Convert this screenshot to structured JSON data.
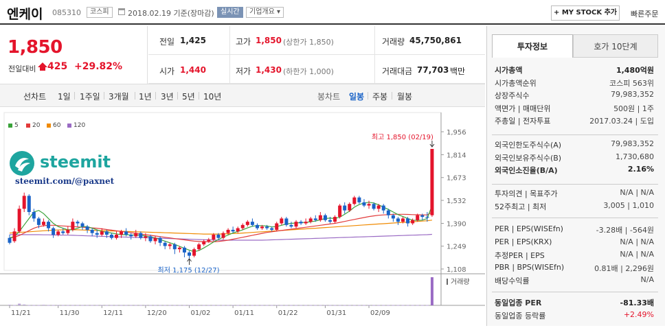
{
  "header": {
    "name": "엔케이",
    "code": "085310",
    "market": "코스피",
    "date": "2018.02.19 기준(장마감)",
    "realtime": "실시간",
    "corp_info": "기업개요 ▾",
    "my_stock": "+ MY STOCK 추가",
    "quick_order": "빠른주문"
  },
  "price": {
    "current": "1,850",
    "diff_label": "전일대비",
    "diff": "425",
    "rate": "+29.82%"
  },
  "summary": {
    "prev_label": "전일",
    "prev": "1,425",
    "high_label": "고가",
    "high": "1,850",
    "high_sub": "(상한가 1,850)",
    "volume_label": "거래량",
    "volume": "45,750,861",
    "open_label": "시가",
    "open": "1,440",
    "low_label": "저가",
    "low": "1,430",
    "low_sub": "(하한가 1,000)",
    "amount_label": "거래대금",
    "amount": "77,703",
    "amount_unit": "백만"
  },
  "tabs": {
    "line": "선차트",
    "d1": "1일",
    "w1": "1주일",
    "m3": "3개월",
    "y1": "1년",
    "y3": "3년",
    "y5": "5년",
    "y10": "10년",
    "candle": "봉차트",
    "daily": "일봉",
    "weekly": "주봉",
    "monthly": "월봉"
  },
  "right": {
    "tab_info": "투자정보",
    "tab_quote": "호가 10단계",
    "rows1": [
      {
        "l": "시가총액",
        "r": "1,480억원",
        "bold": true
      },
      {
        "l": "시가총액순위",
        "r": "코스피 563위"
      },
      {
        "l": "상장주식수",
        "r": "79,983,352"
      },
      {
        "l": "액면가 | 매매단위",
        "r": "500원 | 1주"
      },
      {
        "l": "주총일 | 전자투표",
        "r": "2017.03.24 | 도입"
      }
    ],
    "rows2": [
      {
        "l": "외국인한도주식수(A)",
        "r": "79,983,352"
      },
      {
        "l": "외국인보유주식수(B)",
        "r": "1,730,680"
      },
      {
        "l": "외국인소진율(B/A)",
        "r": "2.16%",
        "bold": true
      }
    ],
    "rows3": [
      {
        "l": "투자의견 | 목표주가",
        "r": "N/A | N/A"
      },
      {
        "l": "52주최고 | 최저",
        "r": "3,005 | 1,010"
      }
    ],
    "rows4": [
      {
        "l": "PER | EPS(WISEfn)",
        "r": "-3.28배 | -564원"
      },
      {
        "l": "PER | EPS(KRX)",
        "r": "N/A | N/A"
      },
      {
        "l": "추정PER | EPS",
        "r": "N/A | N/A"
      },
      {
        "l": "PBR | BPS(WISEfn)",
        "r": "0.81배 | 2,296원"
      },
      {
        "l": "배당수익률",
        "r": "N/A"
      }
    ],
    "rows5": [
      {
        "l": "동일업종 PER",
        "r": "-81.33배",
        "bold": true
      },
      {
        "l": "동일업종 등락률",
        "r": "+2.49%",
        "red": true
      }
    ]
  },
  "watermark": {
    "brand": "steemit",
    "url": "steemit.com/@paxnet"
  },
  "colors": {
    "up": "#e4142b",
    "down": "#1a63c7",
    "ma5": "#3aa23a",
    "ma20": "#e23a3a",
    "ma60": "#f08a00",
    "ma120": "#9a6bc4",
    "steemit": "#1ea59f"
  },
  "chart_data": {
    "type": "candlestick",
    "legend": [
      "5",
      "20",
      "60",
      "120"
    ],
    "y_ticks": [
      "1,956",
      "1,814",
      "1,673",
      "1,532",
      "1,390",
      "1,249",
      "1,108"
    ],
    "ylim": [
      1108,
      1956
    ],
    "x_ticks": [
      "11/21",
      "11/30",
      "12/11",
      "12/20",
      "01/02",
      "01/11",
      "01/22",
      "01/31",
      "02/09"
    ],
    "high_annotation": "최고 1,850 (02/19)",
    "low_annotation": "최저 1,175 (12/27)",
    "volume_label": "거래량",
    "candles": [
      [
        1300,
        1270,
        1320,
        1260
      ],
      [
        1280,
        1340,
        1360,
        1270
      ],
      [
        1340,
        1480,
        1500,
        1330
      ],
      [
        1480,
        1560,
        1580,
        1460
      ],
      [
        1560,
        1460,
        1570,
        1440
      ],
      [
        1460,
        1420,
        1480,
        1400
      ],
      [
        1420,
        1380,
        1430,
        1360
      ],
      [
        1380,
        1400,
        1420,
        1370
      ],
      [
        1400,
        1360,
        1410,
        1340
      ],
      [
        1360,
        1320,
        1370,
        1300
      ],
      [
        1320,
        1340,
        1350,
        1310
      ],
      [
        1340,
        1330,
        1360,
        1320
      ],
      [
        1330,
        1350,
        1370,
        1320
      ],
      [
        1350,
        1400,
        1420,
        1340
      ],
      [
        1400,
        1390,
        1410,
        1370
      ],
      [
        1390,
        1370,
        1400,
        1350
      ],
      [
        1370,
        1350,
        1380,
        1330
      ],
      [
        1350,
        1330,
        1360,
        1310
      ],
      [
        1330,
        1320,
        1350,
        1300
      ],
      [
        1320,
        1340,
        1360,
        1310
      ],
      [
        1340,
        1320,
        1350,
        1300
      ],
      [
        1320,
        1300,
        1330,
        1290
      ],
      [
        1300,
        1320,
        1340,
        1290
      ],
      [
        1320,
        1340,
        1350,
        1300
      ],
      [
        1340,
        1320,
        1360,
        1310
      ],
      [
        1320,
        1310,
        1330,
        1290
      ],
      [
        1310,
        1330,
        1350,
        1300
      ],
      [
        1330,
        1300,
        1340,
        1290
      ],
      [
        1300,
        1310,
        1330,
        1280
      ],
      [
        1310,
        1280,
        1320,
        1270
      ],
      [
        1280,
        1300,
        1310,
        1260
      ],
      [
        1300,
        1270,
        1310,
        1250
      ],
      [
        1270,
        1250,
        1280,
        1230
      ],
      [
        1250,
        1260,
        1270,
        1230
      ],
      [
        1260,
        1230,
        1270,
        1200
      ],
      [
        1230,
        1240,
        1250,
        1210
      ],
      [
        1240,
        1210,
        1250,
        1180
      ],
      [
        1210,
        1190,
        1220,
        1175
      ],
      [
        1190,
        1230,
        1240,
        1180
      ],
      [
        1230,
        1260,
        1270,
        1220
      ],
      [
        1260,
        1280,
        1290,
        1250
      ],
      [
        1280,
        1290,
        1300,
        1270
      ],
      [
        1290,
        1320,
        1330,
        1280
      ],
      [
        1320,
        1300,
        1330,
        1290
      ],
      [
        1300,
        1330,
        1340,
        1290
      ],
      [
        1330,
        1350,
        1360,
        1320
      ],
      [
        1350,
        1340,
        1370,
        1330
      ],
      [
        1340,
        1360,
        1370,
        1330
      ],
      [
        1360,
        1380,
        1390,
        1350
      ],
      [
        1380,
        1400,
        1410,
        1370
      ],
      [
        1400,
        1380,
        1420,
        1370
      ],
      [
        1380,
        1360,
        1390,
        1350
      ],
      [
        1360,
        1370,
        1380,
        1350
      ],
      [
        1370,
        1360,
        1380,
        1350
      ],
      [
        1360,
        1350,
        1370,
        1340
      ],
      [
        1350,
        1390,
        1400,
        1340
      ],
      [
        1390,
        1420,
        1430,
        1380
      ],
      [
        1420,
        1380,
        1430,
        1370
      ],
      [
        1380,
        1370,
        1400,
        1360
      ],
      [
        1370,
        1400,
        1410,
        1360
      ],
      [
        1400,
        1390,
        1410,
        1380
      ],
      [
        1390,
        1400,
        1420,
        1380
      ],
      [
        1400,
        1420,
        1430,
        1390
      ],
      [
        1420,
        1410,
        1440,
        1400
      ],
      [
        1410,
        1440,
        1460,
        1400
      ],
      [
        1440,
        1410,
        1450,
        1400
      ],
      [
        1410,
        1400,
        1430,
        1390
      ],
      [
        1400,
        1430,
        1440,
        1390
      ],
      [
        1430,
        1500,
        1510,
        1420
      ],
      [
        1500,
        1470,
        1520,
        1450
      ],
      [
        1470,
        1510,
        1520,
        1460
      ],
      [
        1510,
        1550,
        1560,
        1500
      ],
      [
        1550,
        1520,
        1560,
        1510
      ],
      [
        1520,
        1500,
        1540,
        1490
      ],
      [
        1500,
        1510,
        1530,
        1480
      ],
      [
        1510,
        1480,
        1520,
        1470
      ],
      [
        1480,
        1500,
        1510,
        1460
      ],
      [
        1500,
        1470,
        1510,
        1450
      ],
      [
        1470,
        1440,
        1480,
        1420
      ],
      [
        1440,
        1420,
        1450,
        1400
      ],
      [
        1420,
        1400,
        1430,
        1380
      ],
      [
        1400,
        1420,
        1430,
        1390
      ],
      [
        1420,
        1390,
        1430,
        1370
      ],
      [
        1390,
        1410,
        1420,
        1380
      ],
      [
        1410,
        1440,
        1450,
        1400
      ],
      [
        1440,
        1430,
        1450,
        1410
      ],
      [
        1430,
        1425,
        1460,
        1400
      ],
      [
        1440,
        1850,
        1850,
        1430
      ]
    ],
    "volumes": [
      2,
      1,
      6,
      3,
      1,
      1,
      1,
      2,
      1,
      1,
      1,
      1,
      1,
      1,
      1,
      1,
      1,
      1,
      1,
      1,
      1,
      1,
      1,
      1,
      1,
      1,
      1,
      1,
      1,
      1,
      1,
      1,
      1,
      1,
      1,
      1,
      1,
      1,
      1,
      1,
      1,
      1,
      1,
      1,
      1,
      1,
      1,
      1,
      1,
      1,
      1,
      1,
      1,
      1,
      1,
      1,
      1,
      1,
      1,
      1,
      1,
      1,
      1,
      1,
      1,
      1,
      1,
      1,
      1,
      1,
      1,
      1,
      1,
      1,
      1,
      1,
      1,
      1,
      1,
      1,
      1,
      1,
      1,
      1,
      1,
      1,
      1,
      100
    ],
    "ma5": [
      1300,
      1310,
      1340,
      1380,
      1420,
      1460,
      1470,
      1450,
      1420,
      1390,
      1370,
      1360,
      1350,
      1350,
      1360,
      1370,
      1370,
      1360,
      1350,
      1340,
      1335,
      1330,
      1325,
      1320,
      1320,
      1318,
      1318,
      1316,
      1312,
      1306,
      1300,
      1290,
      1280,
      1270,
      1260,
      1248,
      1236,
      1224,
      1215,
      1222,
      1238,
      1256,
      1275,
      1290,
      1305,
      1318,
      1330,
      1340,
      1350,
      1362,
      1372,
      1376,
      1376,
      1374,
      1368,
      1370,
      1378,
      1386,
      1390,
      1392,
      1395,
      1396,
      1400,
      1404,
      1412,
      1420,
      1422,
      1420,
      1428,
      1446,
      1466,
      1490,
      1506,
      1516,
      1520,
      1516,
      1504,
      1490,
      1476,
      1460,
      1444,
      1432,
      1420,
      1410,
      1408,
      1410,
      1420,
      1500
    ],
    "ma20": [
      1300,
      1305,
      1315,
      1330,
      1345,
      1360,
      1370,
      1375,
      1378,
      1378,
      1376,
      1374,
      1372,
      1370,
      1368,
      1366,
      1364,
      1362,
      1360,
      1356,
      1352,
      1348,
      1344,
      1340,
      1336,
      1332,
      1328,
      1324,
      1320,
      1316,
      1312,
      1308,
      1304,
      1300,
      1296,
      1292,
      1288,
      1284,
      1280,
      1278,
      1276,
      1276,
      1276,
      1278,
      1282,
      1286,
      1292,
      1298,
      1304,
      1310,
      1316,
      1322,
      1328,
      1334,
      1338,
      1342,
      1346,
      1350,
      1354,
      1358,
      1362,
      1366,
      1370,
      1374,
      1378,
      1382,
      1386,
      1390,
      1396,
      1402,
      1408,
      1414,
      1420,
      1426,
      1432,
      1436,
      1440,
      1442,
      1444,
      1446,
      1446,
      1446,
      1445,
      1444,
      1443,
      1442,
      1442,
      1460
    ],
    "ma60": [
      1330,
      1332,
      1334,
      1336,
      1338,
      1340,
      1342,
      1344,
      1346,
      1348,
      1349,
      1350,
      1350,
      1350,
      1350,
      1349,
      1348,
      1347,
      1346,
      1345,
      1344,
      1343,
      1342,
      1341,
      1340,
      1339,
      1338,
      1337,
      1336,
      1335,
      1334,
      1333,
      1332,
      1331,
      1330,
      1329,
      1328,
      1327,
      1326,
      1325,
      1324,
      1324,
      1324,
      1324,
      1325,
      1326,
      1327,
      1328,
      1330,
      1332,
      1334,
      1336,
      1338,
      1340,
      1342,
      1344,
      1346,
      1348,
      1350,
      1352,
      1354,
      1356,
      1358,
      1360,
      1362,
      1364,
      1366,
      1368,
      1370,
      1372,
      1374,
      1376,
      1378,
      1380,
      1382,
      1384,
      1386,
      1388,
      1390,
      1392,
      1394,
      1396,
      1398,
      1400,
      1402,
      1404,
      1406,
      1410
    ],
    "ma120": [
      1320,
      1320,
      1320,
      1320,
      1320,
      1320,
      1320,
      1319,
      1319,
      1318,
      1318,
      1317,
      1317,
      1316,
      1315,
      1314,
      1313,
      1312,
      1311,
      1310,
      1309,
      1308,
      1307,
      1306,
      1305,
      1304,
      1303,
      1302,
      1301,
      1300,
      1299,
      1298,
      1297,
      1296,
      1295,
      1294,
      1293,
      1292,
      1291,
      1290,
      1289,
      1288,
      1287,
      1286,
      1286,
      1286,
      1286,
      1286,
      1286,
      1286,
      1286,
      1286,
      1286,
      1287,
      1288,
      1289,
      1290,
      1291,
      1292,
      1293,
      1294,
      1295,
      1296,
      1297,
      1298,
      1299,
      1300,
      1301,
      1302,
      1303,
      1304,
      1305,
      1306,
      1307,
      1308,
      1309,
      1310,
      1311,
      1312,
      1313,
      1314,
      1315,
      1316,
      1317,
      1318,
      1319,
      1320,
      1322
    ]
  }
}
